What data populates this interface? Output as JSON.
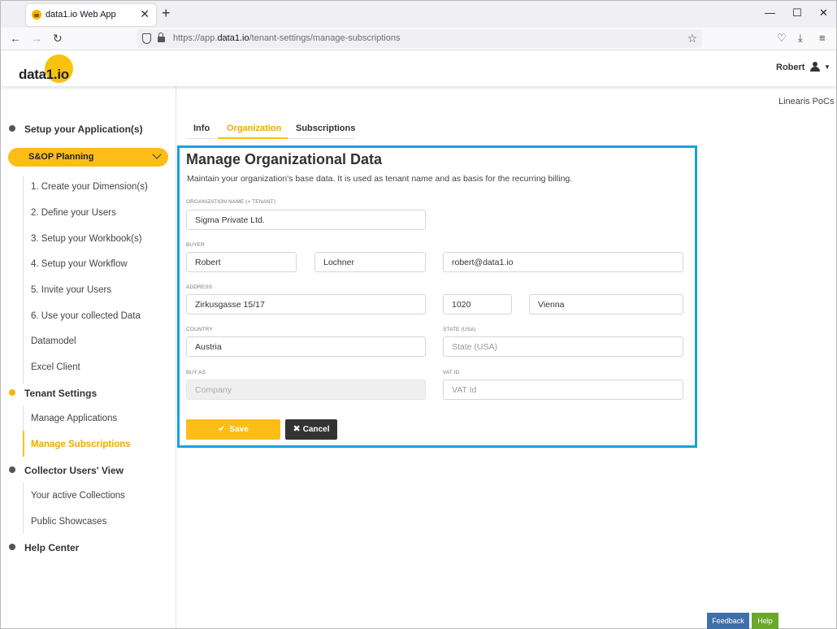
{
  "browser": {
    "tab_title": "data1.io Web App",
    "tab_close": "✕",
    "new_tab": "+",
    "url_prefix": "https://app.",
    "url_domain": "data1.io",
    "url_path": "/tenant-settings/manage-subscriptions",
    "window_controls": [
      "—",
      "☐",
      "✕"
    ]
  },
  "header": {
    "logo": "data1.io",
    "user": "Robert"
  },
  "sidebar": {
    "sections": [
      {
        "label": "Setup your Application(s)"
      },
      {
        "label": "Tenant Settings"
      },
      {
        "label": "Collector Users' View"
      },
      {
        "label": "Help Center"
      }
    ],
    "app_pill": "S&OP Planning",
    "setup_items": [
      "1. Create your Dimension(s)",
      "2. Define your Users",
      "3. Setup your Workbook(s)",
      "4. Setup your Workflow",
      "5. Invite your Users",
      "6. Use your collected Data",
      "Datamodel",
      "Excel Client"
    ],
    "tenant_items": [
      "Manage Applications",
      "Manage Subscriptions"
    ],
    "collector_items": [
      "Your active Collections",
      "Public Showcases"
    ]
  },
  "main": {
    "tenant_name": "Linearis PoCs",
    "tabs": [
      "Info",
      "Organization",
      "Subscriptions"
    ],
    "active_tab": "Organization",
    "title": "Manage Organizational Data",
    "description": "Maintain your organization's base data. It is used as tenant name and as basis for the recurring billing.",
    "labels": {
      "org_name": "ORGANIZATION NAME (= TENANT)",
      "buyer": "BUYER",
      "address": "ADDRESS",
      "country": "COUNTRY",
      "state": "STATE (USA)",
      "buy_as": "BUY AS",
      "vat": "VAT ID"
    },
    "values": {
      "org_name": "Sigma Private Ltd.",
      "first_name": "Robert",
      "last_name": "Lochner",
      "email": "robert@data1.io",
      "street": "Zirkusgasse 15/17",
      "zip": "1020",
      "city": "Vienna",
      "country": "Austria"
    },
    "placeholders": {
      "state": "State (USA)",
      "buy_as": "Company",
      "vat": "VAT Id"
    },
    "save": "Save",
    "cancel": "Cancel"
  },
  "footer": {
    "feedback": "Feedback",
    "help": "Help"
  },
  "colors": {
    "accent": "#fbbd16",
    "card_border": "#1aa1d8",
    "feedback": "#3f6fa8",
    "help": "#6aa82a"
  }
}
